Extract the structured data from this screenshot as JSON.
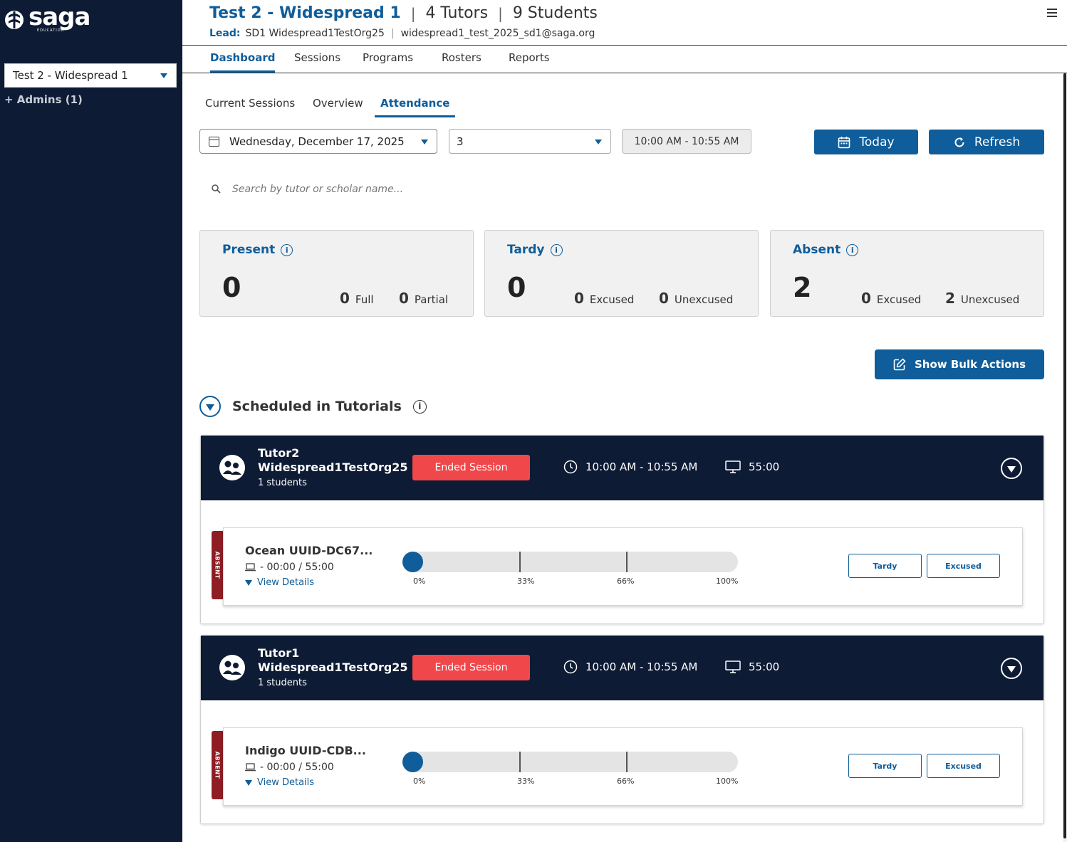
{
  "brand": {
    "logo": "saga",
    "logo_sub": "EDUCATION"
  },
  "sidebar": {
    "org_selected": "Test 2 - Widespread 1",
    "admins": "+ Admins (1)"
  },
  "header": {
    "title": "Test 2 - Widespread 1",
    "tutors": "4 Tutors",
    "students": "9 Students",
    "lead_label": "Lead:",
    "lead_name": "SD1 Widespread1TestOrg25",
    "lead_email": "widespread1_test_2025_sd1@saga.org"
  },
  "nav": [
    {
      "label": "Dashboard",
      "active": true
    },
    {
      "label": "Sessions",
      "active": false
    },
    {
      "label": "Programs",
      "active": false
    },
    {
      "label": "Rosters",
      "active": false
    },
    {
      "label": "Reports",
      "active": false
    }
  ],
  "subtabs": [
    {
      "label": "Current Sessions",
      "active": false
    },
    {
      "label": "Overview",
      "active": false
    },
    {
      "label": "Attendance",
      "active": true
    }
  ],
  "filters": {
    "date": "Wednesday, December 17, 2025",
    "period": "3",
    "time_range": "10:00 AM - 10:55 AM",
    "today_label": "Today",
    "refresh_label": "Refresh"
  },
  "search": {
    "placeholder": "Search by tutor or scholar name..."
  },
  "stats": {
    "present": {
      "title": "Present",
      "total": "0",
      "a_val": "0",
      "a_label": "Full",
      "b_val": "0",
      "b_label": "Partial"
    },
    "tardy": {
      "title": "Tardy",
      "total": "0",
      "a_val": "0",
      "a_label": "Excused",
      "b_val": "0",
      "b_label": "Unexcused"
    },
    "absent": {
      "title": "Absent",
      "total": "2",
      "a_val": "0",
      "a_label": "Excused",
      "b_val": "2",
      "b_label": "Unexcused"
    }
  },
  "bulk_actions_label": "Show Bulk Actions",
  "section_title": "Scheduled in Tutorials",
  "tutorials": [
    {
      "name_line1": "Tutor2",
      "name_line2": "Widespread1TestOrg25",
      "students_count": "1 students",
      "status": "Ended Session",
      "time": "10:00 AM - 10:55 AM",
      "duration": "55:00",
      "student": {
        "status_tag": "ABSENT",
        "name": "Ocean UUID-DC67...",
        "time": "- 00:00 / 55:00",
        "details_label": "View Details",
        "progress_percent": 0,
        "labels": [
          "0%",
          "33%",
          "66%",
          "100%"
        ],
        "tardy_label": "Tardy",
        "excused_label": "Excused"
      }
    },
    {
      "name_line1": "Tutor1",
      "name_line2": "Widespread1TestOrg25",
      "students_count": "1 students",
      "status": "Ended Session",
      "time": "10:00 AM - 10:55 AM",
      "duration": "55:00",
      "student": {
        "status_tag": "ABSENT",
        "name": "Indigo UUID-CDB...",
        "time": "- 00:00 / 55:00",
        "details_label": "View Details",
        "progress_percent": 0,
        "labels": [
          "0%",
          "33%",
          "66%",
          "100%"
        ],
        "tardy_label": "Tardy",
        "excused_label": "Excused"
      }
    }
  ],
  "colors": {
    "navy": "#0e1b35",
    "brand_blue": "#0f5d9a",
    "ended_red": "#f0474a",
    "absent_red": "#8f1d24"
  }
}
